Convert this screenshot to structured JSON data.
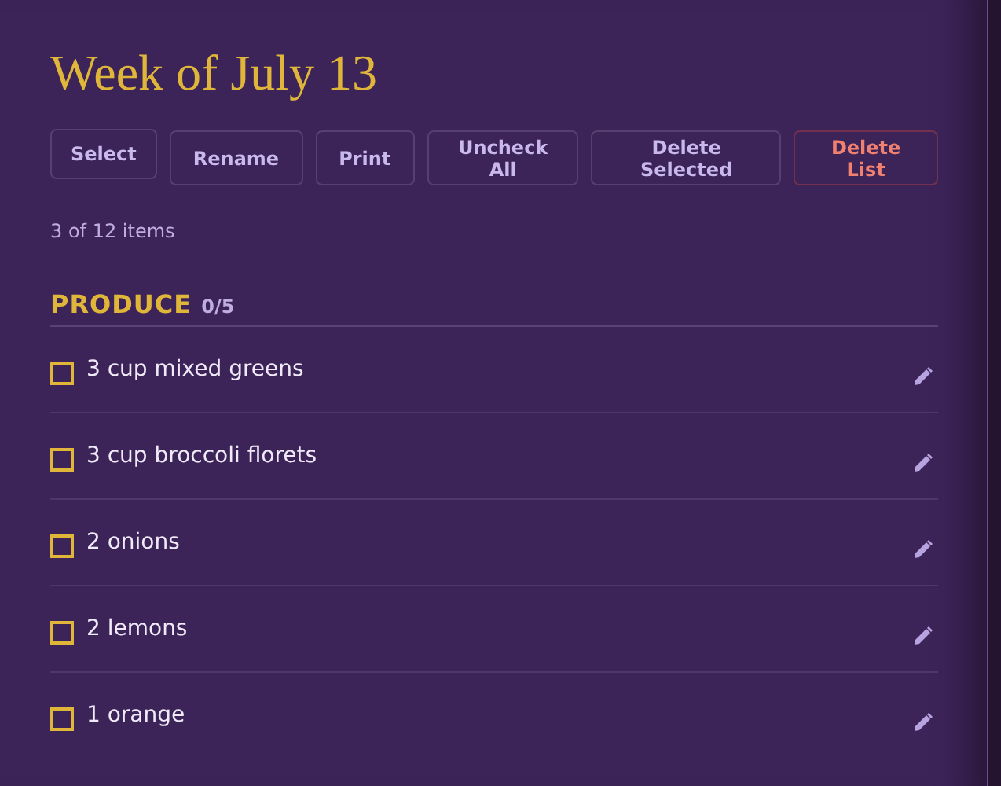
{
  "title": "Week of July 13",
  "buttons": [
    {
      "label": "Select",
      "kind": "compact"
    },
    {
      "label": "Rename",
      "kind": "plain"
    },
    {
      "label": "Print",
      "kind": "plain"
    },
    {
      "label": "Uncheck All",
      "kind": "plain"
    },
    {
      "label": "Delete Selected",
      "kind": "plain"
    },
    {
      "label": "Delete List",
      "kind": "danger"
    }
  ],
  "count": "3 of 12 items",
  "sections": [
    {
      "name": "PRODUCE",
      "progress": "0/5",
      "items": [
        {
          "text": "3 cup mixed greens",
          "checked": false
        },
        {
          "text": "3 cup broccoli florets",
          "checked": false
        },
        {
          "text": "2 onions",
          "checked": false
        },
        {
          "text": "2 lemons",
          "checked": false
        },
        {
          "text": "1 orange",
          "checked": false
        }
      ]
    }
  ]
}
